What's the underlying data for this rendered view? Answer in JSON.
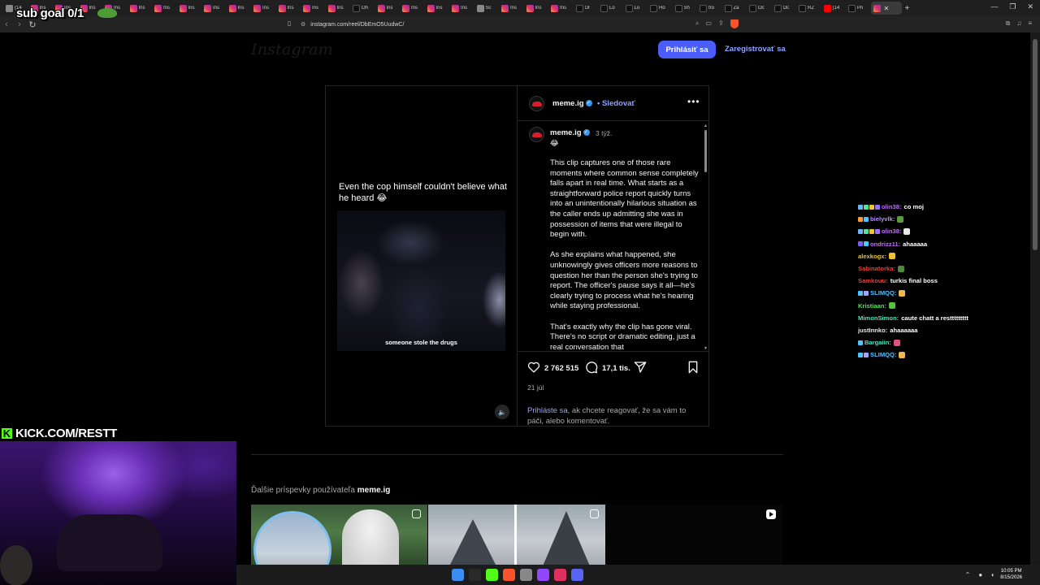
{
  "browser": {
    "tabs": [
      {
        "icon": "gn",
        "title": "(14"
      },
      {
        "icon": "ig",
        "title": "Ins"
      },
      {
        "icon": "ig",
        "title": "Ins"
      },
      {
        "icon": "ig",
        "title": "Ins"
      },
      {
        "icon": "ig",
        "title": "Ins"
      },
      {
        "icon": "ig",
        "title": "Ins"
      },
      {
        "icon": "ig",
        "title": "Ins"
      },
      {
        "icon": "ig",
        "title": "Ins"
      },
      {
        "icon": "ig",
        "title": "Ins"
      },
      {
        "icon": "ig",
        "title": "Ins"
      },
      {
        "icon": "ig",
        "title": "Ins"
      },
      {
        "icon": "ig",
        "title": "Ins"
      },
      {
        "icon": "ig",
        "title": "Ins"
      },
      {
        "icon": "ig",
        "title": "Ins"
      },
      {
        "icon": "tt",
        "title": "Oh"
      },
      {
        "icon": "ig",
        "title": "Ins"
      },
      {
        "icon": "ig",
        "title": "Ins"
      },
      {
        "icon": "ig",
        "title": "Ins"
      },
      {
        "icon": "ig",
        "title": "Ins"
      },
      {
        "icon": "gn",
        "title": "Sc"
      },
      {
        "icon": "ig",
        "title": "Ins"
      },
      {
        "icon": "ig",
        "title": "Ins"
      },
      {
        "icon": "ig",
        "title": "Ins"
      },
      {
        "icon": "tt",
        "title": "Or"
      },
      {
        "icon": "tt",
        "title": "Lo"
      },
      {
        "icon": "tt",
        "title": "Lo"
      },
      {
        "icon": "tt",
        "title": "Ho"
      },
      {
        "icon": "tt",
        "title": "Sh"
      },
      {
        "icon": "tt",
        "title": "tro"
      },
      {
        "icon": "tt",
        "title": "Za"
      },
      {
        "icon": "tt",
        "title": "Oc"
      },
      {
        "icon": "tt",
        "title": "Oc"
      },
      {
        "icon": "tt",
        "title": "RŽ"
      },
      {
        "icon": "yt",
        "title": "(14"
      },
      {
        "icon": "tt",
        "title": "Pri"
      }
    ],
    "active_tab_icon": "ig",
    "url": "instagram.com/reel/DbEmO5UudwC/"
  },
  "instagram": {
    "logo": "Instagram",
    "login_button": "Prihlásiť sa",
    "register_link": "Zaregistrovať sa",
    "video_caption": "Even the cop himself couldn't believe what he heard 😂",
    "video_subtitle": "someone stole the drugs",
    "username": "meme.ig",
    "follow_label": "Sledovať",
    "more_icon": "•••",
    "comment_time": "3 týž.",
    "comment_emoji": "😂",
    "comment_paragraphs": [
      "This clip captures one of those rare moments where common sense completely falls apart in real time. What starts as a straightforward police report quickly turns into an unintentionally hilarious situation as the caller ends up admitting she was in possession of items that were illegal to begin with.",
      "As she explains what happened, she unknowingly gives officers more reasons to question her than the person she's trying to report. The officer's pause says it all—he's clearly trying to process what he's hearing while staying professional.",
      "That's exactly why the clip has gone viral. There's no script or dramatic editing, just a real conversation that"
    ],
    "like_count": "2 762 515",
    "comment_count": "17,1 tis.",
    "post_date": "21 júl",
    "login_prompt_link": "Prihláste sa",
    "login_prompt_rest": ", ak chcete reagovať, že sa vám to páči, alebo komentovať.",
    "more_posts_prefix": "Ďalšie príspevky používateľa ",
    "more_posts_user": "meme.ig"
  },
  "chat": [
    {
      "badges": [
        "#6ab6ff",
        "#58e0a0",
        "#f0c040",
        "#9a6cff"
      ],
      "user": "olin38:",
      "user_color": "#c36bff",
      "message": "co moj",
      "emote": ""
    },
    {
      "badges": [
        "#ff9a2e",
        "#4ec4ff"
      ],
      "user": "bielyvlk:",
      "user_color": "#b48cff",
      "message": "",
      "emote": "#5a9c3a"
    },
    {
      "badges": [
        "#6ab6ff",
        "#58e0a0",
        "#f0c040",
        "#9a6cff"
      ],
      "user": "olin38:",
      "user_color": "#c36bff",
      "message": "",
      "emote": "#e8e8e8"
    },
    {
      "badges": [
        "#7a5cff",
        "#4ec4ff"
      ],
      "user": "ondrizz11:",
      "user_color": "#c36bff",
      "message": "ahaaaaa",
      "emote": ""
    },
    {
      "badges": [],
      "user": "alexkogx:",
      "user_color": "#e6c233",
      "message": "",
      "emote": "#f0c030"
    },
    {
      "badges": [],
      "user": "Sabinatorka:",
      "user_color": "#e0423a",
      "message": "",
      "emote": "#4a8c3a"
    },
    {
      "badges": [],
      "user": "Samkouu:",
      "user_color": "#e0423a",
      "message": "turkis final boss",
      "emote": ""
    },
    {
      "badges": [
        "#4ec4ff",
        "#9aa6ff"
      ],
      "user": "SLIMQQ:",
      "user_color": "#4ec4ff",
      "message": "",
      "emote": "#f0b850"
    },
    {
      "badges": [],
      "user": "Kristiaan:",
      "user_color": "#58e060",
      "message": "",
      "emote": "#58c040"
    },
    {
      "badges": [],
      "user": "MimonSimon:",
      "user_color": "#58e0c0",
      "message": "caute chatt a resttttttttt",
      "emote": ""
    },
    {
      "badges": [],
      "user": "justInnko:",
      "user_color": "#e8e8e8",
      "message": "ahaaaaaa",
      "emote": ""
    },
    {
      "badges": [
        "#4ec4ff"
      ],
      "user": "Bargaiin:",
      "user_color": "#58e0c0",
      "message": "",
      "emote": "#e05080"
    },
    {
      "badges": [
        "#4ec4ff",
        "#9aa6ff"
      ],
      "user": "SLIMQQ:",
      "user_color": "#4ec4ff",
      "message": "",
      "emote": "#f0b850"
    }
  ],
  "stream": {
    "sub_goal": "sub goal 0/1",
    "kick_letter": "K",
    "kick_url": "KICK.COM/RESTT"
  },
  "taskbar": {
    "app_colors": [
      "#3b8ef0",
      "#2a2a2a",
      "#53fc18",
      "#fb542b",
      "#888888",
      "#9146ff",
      "#e03060",
      "#5865f2"
    ],
    "time": "10:05 PM",
    "date": "8/15/2026"
  },
  "colors": {
    "accent_blue": "#4a5df9",
    "link_blue": "#8fa4ff",
    "kick_green": "#53fc18"
  }
}
